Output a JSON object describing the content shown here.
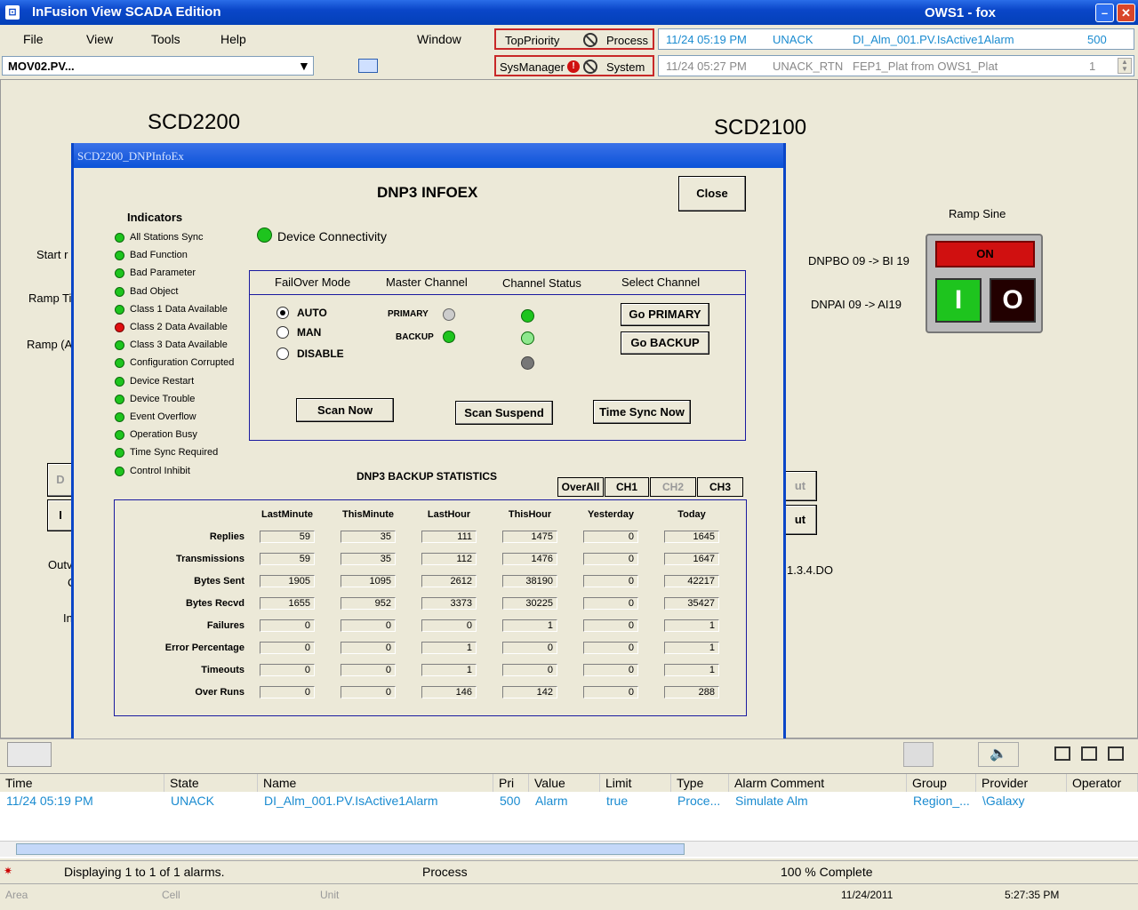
{
  "window": {
    "title": "InFusion View SCADA Edition",
    "host": "OWS1 - fox"
  },
  "menu": {
    "file": "File",
    "view": "View",
    "tools": "Tools",
    "help": "Help",
    "window": "Window"
  },
  "priority": {
    "top": "TopPriority",
    "process": "Process",
    "sysmanager": "SysManager",
    "system": "System"
  },
  "alarm_lines": [
    {
      "time": "11/24 05:19 PM",
      "state": "UNACK",
      "name": "DI_Alm_001.PV.IsActive1Alarm",
      "pri": "500"
    },
    {
      "time": "11/24 05:27 PM",
      "state": "UNACK_RTN",
      "name": "FEP1_Plat from OWS1_Plat",
      "pri": "1"
    }
  ],
  "combo": {
    "value": "MOV02.PV...",
    "arrow": "▼"
  },
  "background": {
    "scd2200": "SCD2200",
    "scd2100": "SCD2100",
    "start": "Start r",
    "ramp_ti": "Ramp Ti",
    "ramp_a": "Ramp (A",
    "outv": "Outv",
    "c": "C",
    "in": "In",
    "ramp_sine": "Ramp Sine",
    "on": "ON",
    "dnpbo": "DNPBO 09 -> BI 19",
    "dnpai": "DNPAI 09 -> AI19",
    "do": "1.3.4.DO",
    "ut1": "ut",
    "ut2": "ut",
    "d": "D",
    "i": "I"
  },
  "dialog": {
    "title": "SCD2200_DNPInfoEx",
    "heading": "DNP3 INFOEX",
    "close": "Close",
    "indicators_title": "Indicators",
    "device_connectivity": "Device Connectivity",
    "indicators": [
      {
        "label": "All Stations Sync",
        "status": "green"
      },
      {
        "label": "Bad Function",
        "status": "green"
      },
      {
        "label": "Bad Parameter",
        "status": "green"
      },
      {
        "label": "Bad Object",
        "status": "green"
      },
      {
        "label": "Class 1 Data Available",
        "status": "green"
      },
      {
        "label": "Class 2 Data Available",
        "status": "red"
      },
      {
        "label": "Class 3 Data Available",
        "status": "green"
      },
      {
        "label": "Configuration Corrupted",
        "status": "green"
      },
      {
        "label": "Device Restart",
        "status": "green"
      },
      {
        "label": "Device Trouble",
        "status": "green"
      },
      {
        "label": "Event Overflow",
        "status": "green"
      },
      {
        "label": "Operation Busy",
        "status": "green"
      },
      {
        "label": "Time Sync Required",
        "status": "green"
      },
      {
        "label": "Control Inhibit",
        "status": "green"
      }
    ],
    "failover_hdr": "FailOver Mode",
    "master_hdr": "Master Channel",
    "status_hdr": "Channel Status",
    "select_hdr": "Select Channel",
    "auto": "AUTO",
    "man": "MAN",
    "disable": "DISABLE",
    "primary": "PRIMARY",
    "backup": "BACKUP",
    "go_primary": "Go PRIMARY",
    "go_backup": "Go BACKUP",
    "scan_now": "Scan Now",
    "scan_suspend": "Scan Suspend",
    "time_sync": "Time Sync Now",
    "stats_title": "DNP3 BACKUP STATISTICS",
    "tabs": [
      "OverAll",
      "CH1",
      "CH2",
      "CH3"
    ],
    "columns": [
      "LastMinute",
      "ThisMinute",
      "LastHour",
      "ThisHour",
      "Yesterday",
      "Today"
    ],
    "rows": [
      {
        "label": "Replies",
        "values": [
          "59",
          "35",
          "111",
          "1475",
          "0",
          "1645"
        ]
      },
      {
        "label": "Transmissions",
        "values": [
          "59",
          "35",
          "112",
          "1476",
          "0",
          "1647"
        ]
      },
      {
        "label": "Bytes Sent",
        "values": [
          "1905",
          "1095",
          "2612",
          "38190",
          "0",
          "42217"
        ]
      },
      {
        "label": "Bytes Recvd",
        "values": [
          "1655",
          "952",
          "3373",
          "30225",
          "0",
          "35427"
        ]
      },
      {
        "label": "Failures",
        "values": [
          "0",
          "0",
          "0",
          "1",
          "0",
          "1"
        ]
      },
      {
        "label": "Error Percentage",
        "values": [
          "0",
          "0",
          "1",
          "0",
          "0",
          "1"
        ]
      },
      {
        "label": "Timeouts",
        "values": [
          "0",
          "0",
          "1",
          "0",
          "0",
          "1"
        ]
      },
      {
        "label": "Over Runs",
        "values": [
          "0",
          "0",
          "146",
          "142",
          "0",
          "288"
        ]
      }
    ]
  },
  "grid": {
    "headers": [
      "Time",
      "State",
      "Name",
      "Pri",
      "Value",
      "Limit",
      "Type",
      "Alarm Comment",
      "Group",
      "Provider",
      "Operator"
    ],
    "row": [
      "11/24 05:19 PM",
      "UNACK",
      "DI_Alm_001.PV.IsActive1Alarm",
      "500",
      "Alarm",
      "true",
      "Proce...",
      "Simulate Alm",
      "Region_...",
      "\\Galaxy",
      ""
    ]
  },
  "status": {
    "displaying": "Displaying 1 to 1 of 1 alarms.",
    "process": "Process",
    "complete": "100 % Complete",
    "area": "Area",
    "cell": "Cell",
    "unit": "Unit",
    "date": "11/24/2011",
    "time": "5:27:35 PM"
  }
}
